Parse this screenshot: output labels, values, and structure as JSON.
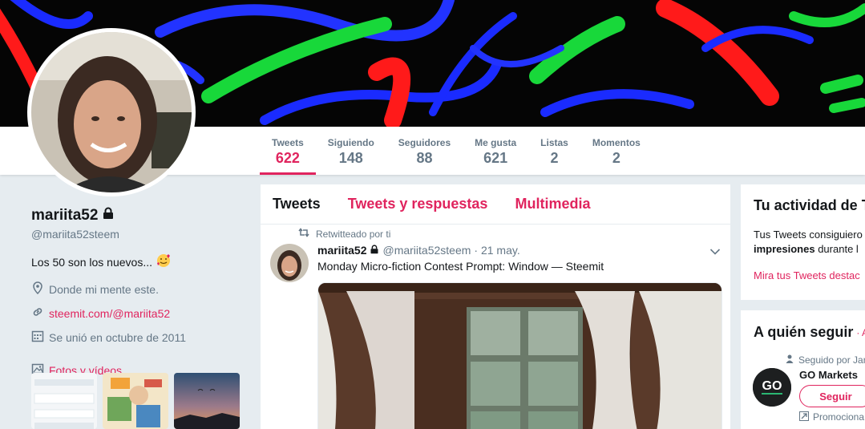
{
  "profile": {
    "name": "mariita52",
    "handle": "@mariita52steem",
    "bio": "Los 50 son los nuevos...",
    "location": "Donde mi mente este.",
    "website": "steemit.com/@mariita52",
    "joined": "Se unió en octubre de 2011",
    "photos_label": "Fotos y vídeos"
  },
  "nav": [
    {
      "label": "Tweets",
      "value": "622"
    },
    {
      "label": "Siguiendo",
      "value": "148"
    },
    {
      "label": "Seguidores",
      "value": "88"
    },
    {
      "label": "Me gusta",
      "value": "621"
    },
    {
      "label": "Listas",
      "value": "2"
    },
    {
      "label": "Momentos",
      "value": "2"
    }
  ],
  "timeline": {
    "tabs": [
      "Tweets",
      "Tweets y respuestas",
      "Multimedia"
    ],
    "retweet_context": "Retwitteado por ti",
    "tweet": {
      "name": "mariita52",
      "handle": "@mariita52steem",
      "date": "· 21 may.",
      "text": "Monday Micro-fiction Contest Prompt: Window — Steemit"
    }
  },
  "activity": {
    "title": "Tu actividad de T",
    "text_line1": "Tus Tweets consiguiero",
    "text_bold": "impresiones",
    "text_line2_rest": " durante l",
    "link": "Mira tus Tweets destac"
  },
  "who_to_follow": {
    "title": "A quién seguir",
    "title_suffix": "· A",
    "followed_by": "Seguido por Jan",
    "account_name": "GO Markets",
    "follow_button": "Seguir",
    "promoted": "Promociona",
    "logo_text": "GO"
  },
  "colors": {
    "accent": "#e0245e",
    "muted": "#657786",
    "background": "#e6ecf0"
  }
}
